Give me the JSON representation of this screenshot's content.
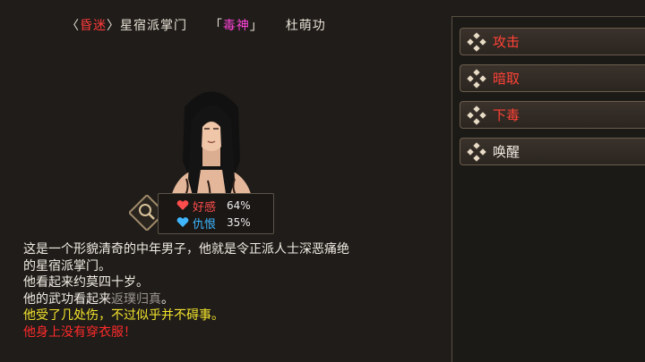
{
  "header": {
    "status_open": "〈",
    "status": "昏迷",
    "status_close": "〉",
    "sect_role": "星宿派掌门",
    "title_open": "「",
    "title": "毒神",
    "title_close": "」",
    "name": "杜萌功"
  },
  "relation": {
    "favor_label": "好感",
    "favor_value": "64%",
    "hatred_label": "仇恨",
    "hatred_value": "35%"
  },
  "description": {
    "line1": "这是一个形貌清奇的中年男子，他就是令正派人士深恶痛绝",
    "line2": "的星宿派掌门。",
    "line3": "他看起来约莫四十岁。",
    "line4_prefix": "他的武功看起来",
    "line4_level": "返璞归真",
    "line4_suffix": "。",
    "line5": "他受了几处伤，不过似乎并不碍事。",
    "line6": "他身上没有穿衣服！"
  },
  "actions": [
    {
      "label": "攻击",
      "color": "#ff4236"
    },
    {
      "label": "暗取",
      "color": "#ff4236"
    },
    {
      "label": "下毒",
      "color": "#ff4236"
    },
    {
      "label": "唤醒",
      "color": "#f0ebe2"
    }
  ],
  "icons": {
    "action": "diamond-icon",
    "favor": "heart-icon",
    "hatred": "heart-icon",
    "inspect": "magnifier-icon"
  },
  "colors": {
    "background": "#1f1c19",
    "status": "#ff3b3b",
    "title": "#ff43d9",
    "favor": "#ff4d4d",
    "hatred": "#3fb6ff",
    "warning_yellow": "#f3e32d",
    "warning_red": "#ff2b2b"
  }
}
